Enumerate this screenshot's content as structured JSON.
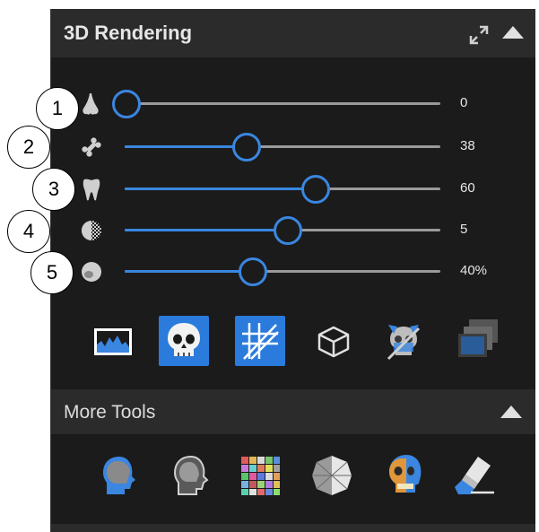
{
  "panel": {
    "title": "3D Rendering",
    "icons": {
      "expand": "expand-arrows-icon",
      "collapse": "triangle-up-icon"
    }
  },
  "sliders": [
    {
      "callout": "1",
      "icon": "nose-soft-tissue-icon",
      "value": "0",
      "level": 0.0
    },
    {
      "callout": "2",
      "icon": "bone-icon",
      "value": "38",
      "level": 0.38
    },
    {
      "callout": "3",
      "icon": "tooth-icon",
      "value": "60",
      "level": 0.6
    },
    {
      "callout": "4",
      "icon": "dither-sphere-icon",
      "value": "5",
      "level": 0.51
    },
    {
      "callout": "5",
      "icon": "opacity-icon",
      "value": "40%",
      "level": 0.4
    }
  ],
  "toolbar": [
    {
      "name": "histogram-icon",
      "active": false
    },
    {
      "name": "skull-render-icon",
      "active": true
    },
    {
      "name": "clip-lines-icon",
      "active": true
    },
    {
      "name": "cube-outline-icon",
      "active": false
    },
    {
      "name": "skull-crossed-icon",
      "active": false
    },
    {
      "name": "overlay-windows-icon",
      "active": false
    }
  ],
  "more_tools": {
    "title": "More Tools",
    "items": [
      "head-profile-blue-icon",
      "head-profile-outline-icon",
      "color-palette-grid-icon",
      "low-poly-sphere-icon",
      "skull-orange-icon",
      "eraser-icon"
    ]
  },
  "colors": {
    "accent": "#3a86e0",
    "panel": "#1b1b1b",
    "header": "#2b2b2b",
    "text": "#e6e6e6"
  }
}
